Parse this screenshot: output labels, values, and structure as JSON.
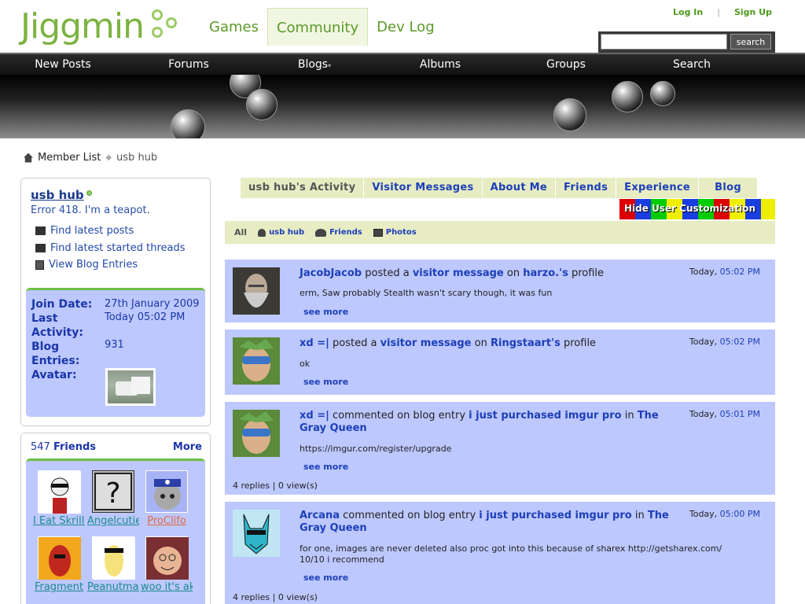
{
  "site": {
    "logo_text": "Jiggmin",
    "nav": [
      {
        "label": "Games"
      },
      {
        "label": "Community"
      },
      {
        "label": "Dev Log"
      }
    ],
    "login": "Log In",
    "signup": "Sign Up",
    "search_button": "search",
    "search_placeholder": ""
  },
  "navbar": [
    "New Posts",
    "Forums",
    "Blogs",
    "Albums",
    "Groups",
    "Search"
  ],
  "breadcrumb": {
    "root": "Member List",
    "current": "usb hub"
  },
  "profile": {
    "name": "usb hub",
    "title": "Error 418. I'm a teapot.",
    "links": [
      "Find latest posts",
      "Find latest started threads",
      "View Blog Entries"
    ],
    "stats": {
      "join_label": "Join Date:",
      "join_value": "27th January 2009",
      "last_label_1": "Last",
      "last_label_2": "Activity:",
      "last_value": "Today 05:02 PM",
      "blog_label_1": "Blog",
      "blog_label_2": "Entries:",
      "blog_value": "931",
      "avatar_label": "Avatar:"
    }
  },
  "friends": {
    "count": "547",
    "label": "Friends",
    "more": "More",
    "items": [
      {
        "name": "I Eat Skrillex"
      },
      {
        "name": "Angelcutie"
      },
      {
        "name": "ProClifo"
      },
      {
        "name": "Fragment"
      },
      {
        "name": "Peanutman"
      },
      {
        "name": "woo it's akiuo"
      }
    ]
  },
  "tabs": [
    "usb hub's Activity",
    "Visitor Messages",
    "About Me",
    "Friends",
    "Experience",
    "Blog"
  ],
  "hide_button": "Hide User Customization",
  "filter": {
    "all": "All",
    "user": "usb hub",
    "friends": "Friends",
    "photos": "Photos"
  },
  "posts": [
    {
      "user": "JacobJacob",
      "action": " posted a ",
      "target": "visitor message",
      "mid": " on ",
      "target2": "harzo.'s",
      "tail": " profile",
      "time_day": "Today, ",
      "time": "05:02 PM",
      "body": "erm, Saw probably Stealth wasn't scary though, it was fun",
      "see_more": "see more"
    },
    {
      "user": "xd =|",
      "action": " posted a ",
      "target": "visitor message",
      "mid": " on ",
      "target2": "Ringstaart's",
      "tail": " profile",
      "time_day": "Today, ",
      "time": "05:02 PM",
      "body": "ok",
      "see_more": "see more"
    },
    {
      "user": "xd =|",
      "action": " commented on blog entry ",
      "target": "i just purchased imgur pro",
      "mid": " in ",
      "target2": "The Gray Queen",
      "tail": "",
      "time_day": "Today, ",
      "time": "05:01 PM",
      "body": "https://imgur.com/register/upgrade",
      "see_more": "see more",
      "replies": "4 replies | 0 view(s)"
    },
    {
      "user": "Arcana",
      "action": " commented on blog entry ",
      "target": "i just purchased imgur pro",
      "mid": " in ",
      "target2": "The Gray Queen",
      "tail": "",
      "time_day": "Today, ",
      "time": "05:00 PM",
      "body": "for one, images are never deleted also proc got into this because of sharex http://getsharex.com/ 10/10 i recommend",
      "see_more": "see more",
      "replies": "4 replies | 0 view(s)"
    }
  ],
  "colors": {
    "green": "#7cb342",
    "blue": "#1d3fb8",
    "panel": "#bdc8ff",
    "tan": "#e7ecc3"
  }
}
